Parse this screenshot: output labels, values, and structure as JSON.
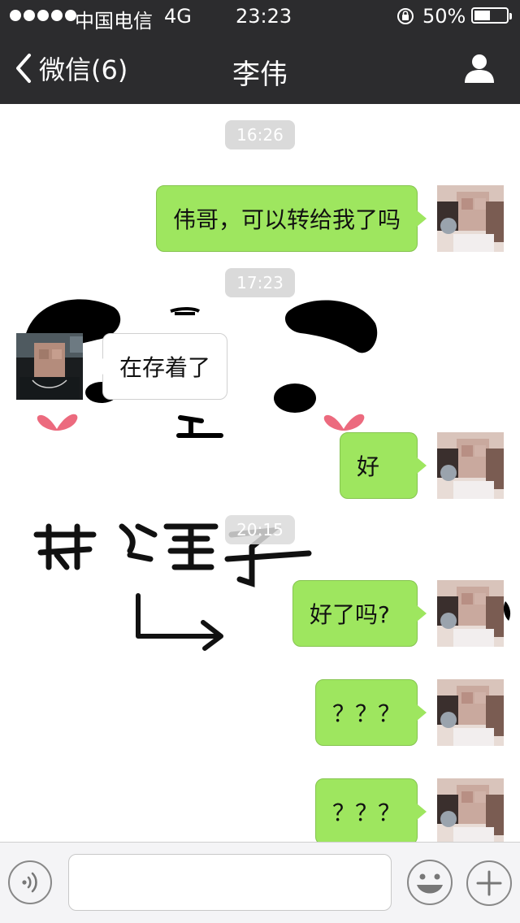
{
  "status_bar": {
    "carrier": "中国电信",
    "network": "4G",
    "time": "23:23",
    "battery_percent": "50%",
    "battery_level": 0.5,
    "signal_bars": 5
  },
  "nav": {
    "back_label": "微信(6)",
    "title": "李伟",
    "back_icon": "chevron-left-icon",
    "profile_icon": "person-icon"
  },
  "timestamps": [
    "16:26",
    "17:23",
    "20:15"
  ],
  "messages": [
    {
      "direction": "out",
      "text": "伟哥，可以转给我了吗"
    },
    {
      "direction": "in",
      "text": "在存着了"
    },
    {
      "direction": "out",
      "text": "好"
    },
    {
      "direction": "out",
      "text": "好了吗?"
    },
    {
      "direction": "out",
      "text": "？？？"
    },
    {
      "direction": "out",
      "text": "？？？"
    }
  ],
  "sticker": {
    "text": "荷猫子"
  },
  "input_bar": {
    "text_value": "",
    "voice_icon": "voice-icon",
    "emoji_icon": "emoji-icon",
    "plus_icon": "plus-icon"
  },
  "colors": {
    "header_bg": "#2c2c2e",
    "outgoing_bubble": "#9ee65f",
    "incoming_bubble": "#ffffff",
    "timestamp_bg": "#dadada"
  }
}
